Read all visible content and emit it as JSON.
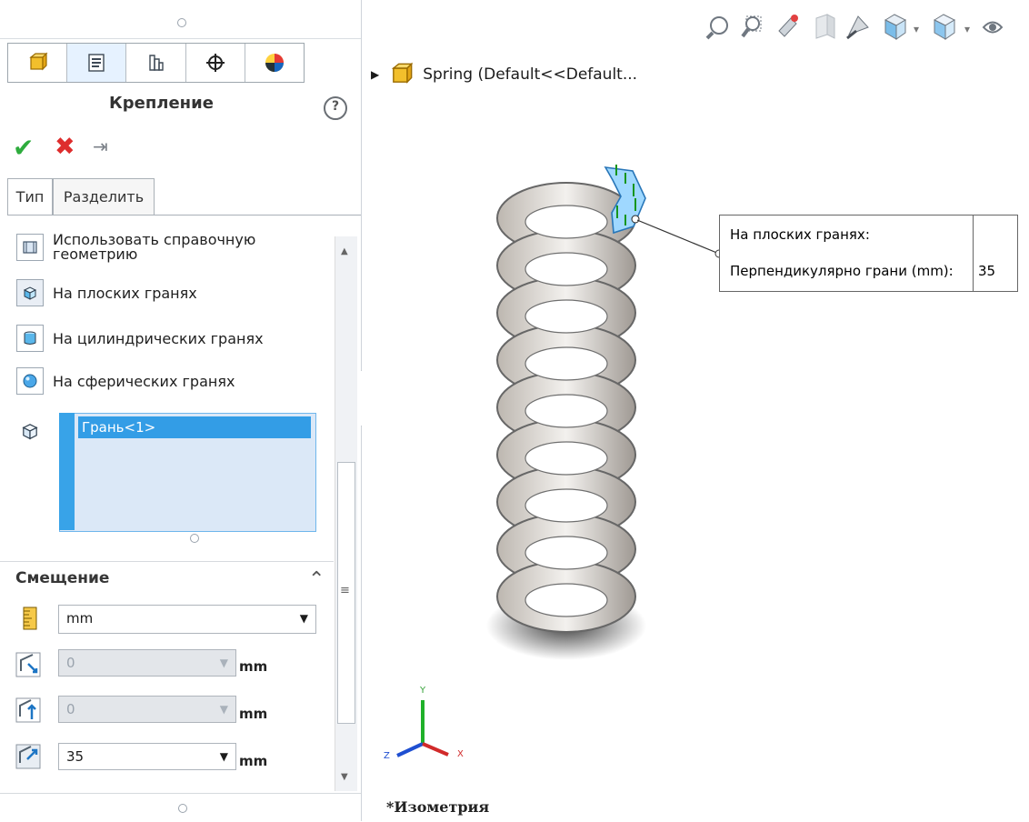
{
  "panel": {
    "title": "Крепление",
    "help_label": "?",
    "tabs": [
      {
        "name": "feature-manager"
      },
      {
        "name": "property-manager"
      },
      {
        "name": "configuration-manager"
      },
      {
        "name": "dim-xpert"
      },
      {
        "name": "display-manager"
      }
    ],
    "subtabs": [
      "Тип",
      "Разделить"
    ],
    "list_items": [
      "Использовать справочную геометрию",
      "На плоских гранях",
      "На цилиндрических гранях",
      "На сферических гранях"
    ],
    "selection": "Грань<1>",
    "offset": {
      "title": "Смещение",
      "unit_select": "mm",
      "field1": "0",
      "field2": "0",
      "field3": "35",
      "unit_label": "mm"
    }
  },
  "viewport": {
    "tree_label": "Spring  (Default<<Default...",
    "callout": {
      "line1": "На плоских гранях:",
      "line2": "Перпендикулярно грани (mm):",
      "value": "35"
    },
    "view_name": "*Изометрия"
  },
  "colors": {
    "accent": "#38a3e8",
    "ok": "#2eac3d",
    "cancel": "#de2d2d"
  }
}
